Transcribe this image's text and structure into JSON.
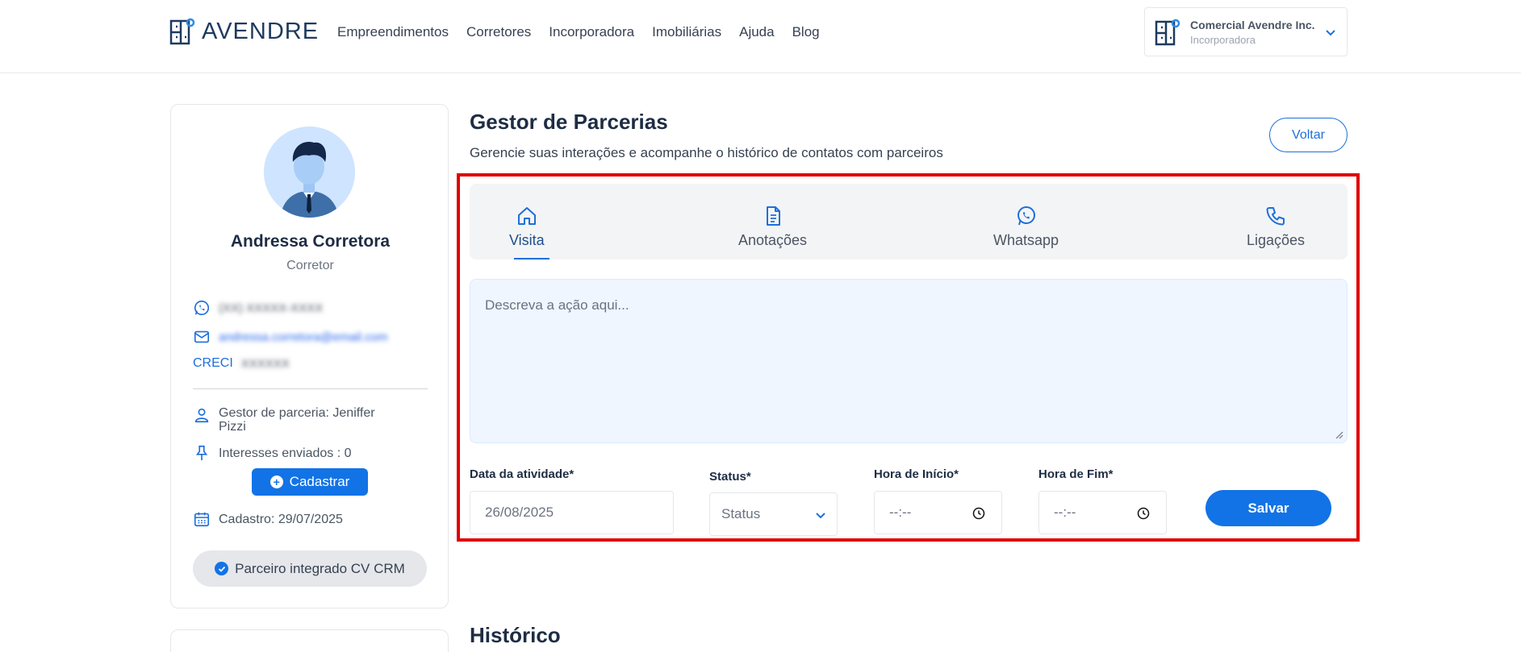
{
  "header": {
    "logo_text": "AVENDRE",
    "nav": [
      "Empreendimentos",
      "Corretores",
      "Incorporadora",
      "Imobiliárias",
      "Ajuda",
      "Blog"
    ],
    "account": {
      "name": "Comercial Avendre Inc.",
      "role": "Incorporadora"
    }
  },
  "profile": {
    "name": "Andressa Corretora",
    "role": "Corretor",
    "phone": "(XX) XXXXX-XXXX",
    "email": "andressa.corretora@email.com",
    "creci_label": "CRECI",
    "creci_value": "XXXXXX",
    "partner_manager": "Gestor de parceria: Jeniffer Pizzi",
    "interests_sent": "Interesses enviados : 0",
    "register_button": "Cadastrar",
    "registered_date": "Cadastro: 29/07/2025",
    "crm_badge": "Parceiro integrado CV CRM"
  },
  "main": {
    "title": "Gestor de Parcerias",
    "subtitle": "Gerencie suas interações e acompanhe o histórico de contatos com parceiros",
    "back_button": "Voltar",
    "tabs": [
      {
        "label": "Visita",
        "icon": "home-icon",
        "active": true
      },
      {
        "label": "Anotações",
        "icon": "document-icon",
        "active": false
      },
      {
        "label": "Whatsapp",
        "icon": "whatsapp-icon",
        "active": false
      },
      {
        "label": "Ligações",
        "icon": "phone-icon",
        "active": false
      }
    ],
    "description_placeholder": "Descreva a ação aqui...",
    "form": {
      "date_label": "Data da atividade*",
      "date_value": "26/08/2025",
      "status_label": "Status*",
      "status_value": "Status",
      "start_label": "Hora de Início*",
      "start_value": "--:--",
      "end_label": "Hora de Fim*",
      "end_value": "--:--",
      "save_button": "Salvar"
    },
    "history_title": "Histórico"
  },
  "colors": {
    "accent": "#1273e6",
    "highlight_frame": "#e00000",
    "title": "#1e2d44"
  }
}
